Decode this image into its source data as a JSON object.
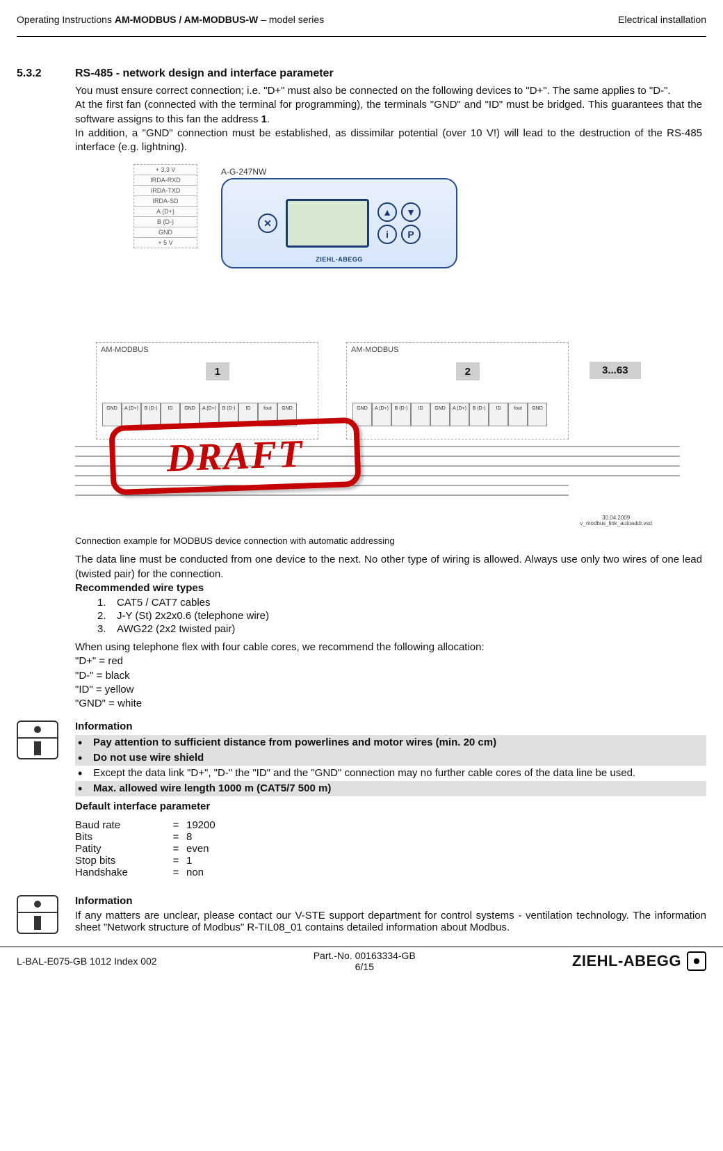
{
  "header": {
    "left_prefix": "Operating Instructions ",
    "left_bold": "AM-MODBUS / AM-MODBUS-W",
    "left_suffix": " – model series",
    "right": "Electrical installation"
  },
  "section": {
    "number": "5.3.2",
    "title": "RS-485 - network design and interface parameter"
  },
  "intro": {
    "p1": "You must ensure correct connection; i.e. \"D+\" must also be connected on the following devices to \"D+\". The same applies to \"D-\".",
    "p2a": "At the first fan (connected with the terminal for programming), the terminals \"GND\" and \"ID\" must be bridged. This guarantees that the software assigns to this fan the address ",
    "p2bold": "1",
    "p2b": ".",
    "p3": "In addition, a \"GND\" connection must be established, as dissimilar potential (over 10 V!) will lead to the destruction of the RS-485 interface (e.g. lightning)."
  },
  "figure": {
    "top_label": "A-G-247NW",
    "terminal_rows": [
      "+ 3,3 V",
      "IRDA-RXD",
      "IRDA-TXD",
      "IRDA-SD",
      "A\n(D+)",
      "B\n(D-)",
      "GND",
      "+ 5 V"
    ],
    "device_brand": "ZIEHL-ABEGG",
    "modbus_title": "AM-MODBUS",
    "addr1": "1",
    "addr2": "2",
    "addr_range": "3...63",
    "strip_labels": [
      "GND",
      "A\n(D+)",
      "B\n(D-)",
      "ID",
      "GND",
      "A\n(D+)",
      "B\n(D-)",
      "ID",
      "fout",
      "GND"
    ],
    "meta_date": "30.04.2009",
    "meta_file": "v_modbus_link_autoaddr.vsd",
    "draft": "DRAFT"
  },
  "caption": "Connection example for MODBUS device connection with automatic addressing",
  "wiring": {
    "p1": "The data line must be conducted from one device to the next. No other type of wiring is allowed. Always use only two wires of one lead (twisted pair) for the connection.",
    "rec_head": "Recommended wire types",
    "items": [
      "CAT5 / CAT7 cables",
      "J-Y (St) 2x2x0.6 (telephone wire)",
      "AWG22 (2x2 twisted pair)"
    ],
    "p2": "When using telephone flex with four cable cores, we recommend the following allocation:",
    "alloc": [
      "\"D+\" = red",
      "\"D-\" = black",
      "\"ID\" = yellow",
      "\"GND\" = white"
    ]
  },
  "info1": {
    "title": "Information",
    "bullets": [
      {
        "t": "Pay attention to sufficient distance from powerlines and motor wires (min. 20 cm)",
        "bold": true,
        "shade": true
      },
      {
        "t": "Do not use wire shield",
        "bold": true,
        "shade": true
      },
      {
        "t": "Except the data link \"D+\", \"D-\" the \"ID\" and the \"GND\" connection may no further cable cores of the data line be used.",
        "bold": false,
        "shade": false
      },
      {
        "t": "Max. allowed wire length 1000 m (CAT5/7 500 m)",
        "bold": true,
        "shade": true
      }
    ],
    "default_head": "Default interface parameter",
    "params": [
      {
        "k": "Baud rate",
        "v": "19200"
      },
      {
        "k": "Bits",
        "v": "8"
      },
      {
        "k": "Patity",
        "v": "even"
      },
      {
        "k": "Stop bits",
        "v": "1"
      },
      {
        "k": "Handshake",
        "v": "non"
      }
    ]
  },
  "info2": {
    "title": "Information",
    "body": "If any matters are unclear,  please contact our V-STE support department for control systems - ventilation technology. The information sheet \"Network structure of Modbus\" R-TIL08_01 contains detailed information about Modbus."
  },
  "footer": {
    "left": "L-BAL-E075-GB 1012 Index 002",
    "center_line1": "Part.-No. 00163334-GB",
    "center_line2": "6/15",
    "brand": "ZIEHL-ABEGG"
  }
}
